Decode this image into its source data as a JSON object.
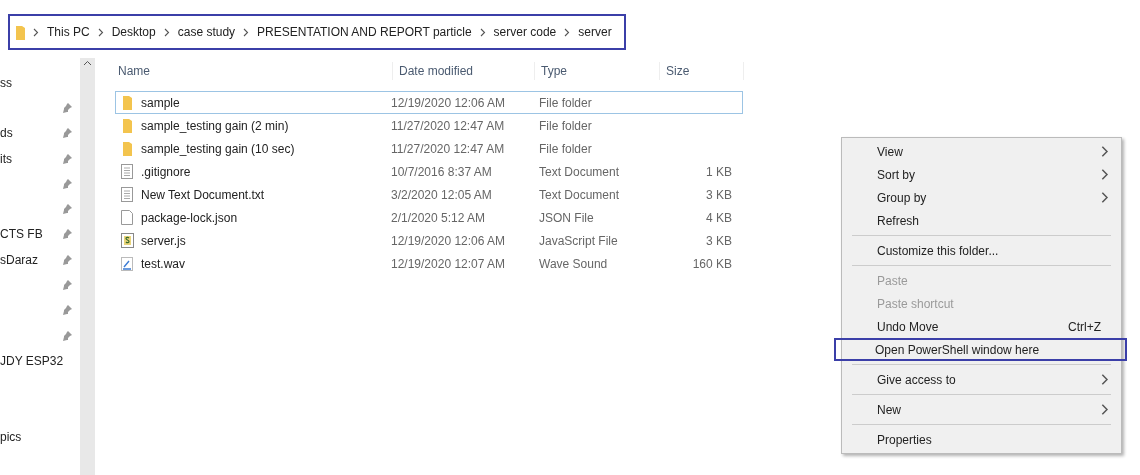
{
  "address_bar": {
    "annotated": true,
    "segments": [
      "This PC",
      "Desktop",
      "case study",
      "PRESENTATION AND REPORT particle",
      "server code",
      "server"
    ]
  },
  "sidebar": {
    "items": [
      {
        "label": "ss",
        "pinned": false
      },
      {
        "pinned": true
      },
      {
        "label": "ds",
        "pinned": true
      },
      {
        "label": "its",
        "pinned": true
      },
      {
        "pinned": true
      },
      {
        "pinned": true
      },
      {
        "label": "CTS FB",
        "pinned": true
      },
      {
        "label": "sDaraz",
        "pinned": true
      },
      {
        "pinned": true
      },
      {
        "pinned": true
      },
      {
        "pinned": true
      },
      {
        "label": "JDY ESP32",
        "pinned": false
      },
      {
        "pinned": false
      },
      {
        "pinned": false
      },
      {
        "label": "pics",
        "pinned": false
      }
    ]
  },
  "table": {
    "columns": [
      "Name",
      "Date modified",
      "Type",
      "Size"
    ],
    "rows": [
      {
        "kind": "folder",
        "name": "sample",
        "date": "12/19/2020 12:06 AM",
        "type": "File folder",
        "focused": true
      },
      {
        "kind": "folder",
        "name": "sample_testing gain (2 min)",
        "date": "11/27/2020 12:47 AM",
        "type": "File folder",
        "focused": false
      },
      {
        "kind": "folder",
        "name": "sample_testing gain (10 sec)",
        "date": "11/27/2020 12:47 AM",
        "type": "File folder",
        "focused": false
      },
      {
        "kind": "text",
        "name": ".gitignore",
        "date": "10/7/2016 8:37 AM",
        "type": "Text Document",
        "size": "1 KB",
        "focused": false
      },
      {
        "kind": "text",
        "name": "New Text Document.txt",
        "date": "3/2/2020 12:05 AM",
        "type": "Text Document",
        "size": "3 KB",
        "focused": false
      },
      {
        "kind": "blank",
        "name": "package-lock.json",
        "date": "2/1/2020 5:12 AM",
        "type": "JSON File",
        "size": "4 KB",
        "focused": false
      },
      {
        "kind": "script",
        "name": "server.js",
        "date": "12/19/2020 12:06 AM",
        "type": "JavaScript File",
        "size": "3 KB",
        "focused": false
      },
      {
        "kind": "audio",
        "name": "test.wav",
        "date": "12/19/2020 12:07 AM",
        "type": "Wave Sound",
        "size": "160 KB",
        "focused": false
      }
    ]
  },
  "context_menu": {
    "items": [
      {
        "kind": "item",
        "label": "View",
        "submenu": true,
        "disabled": false,
        "annotated": false
      },
      {
        "kind": "item",
        "label": "Sort by",
        "submenu": true,
        "disabled": false,
        "annotated": false
      },
      {
        "kind": "item",
        "label": "Group by",
        "submenu": true,
        "disabled": false,
        "annotated": false
      },
      {
        "kind": "item",
        "label": "Refresh",
        "submenu": false,
        "disabled": false,
        "annotated": false
      },
      {
        "kind": "separator"
      },
      {
        "kind": "item",
        "label": "Customize this folder...",
        "submenu": false,
        "disabled": false,
        "annotated": false
      },
      {
        "kind": "separator"
      },
      {
        "kind": "item",
        "label": "Paste",
        "submenu": false,
        "disabled": true,
        "annotated": false
      },
      {
        "kind": "item",
        "label": "Paste shortcut",
        "submenu": false,
        "disabled": true,
        "annotated": false
      },
      {
        "kind": "item",
        "label": "Undo Move",
        "shortcut": "Ctrl+Z",
        "submenu": false,
        "disabled": false,
        "annotated": false
      },
      {
        "kind": "item",
        "label": "Open PowerShell window here",
        "submenu": false,
        "disabled": false,
        "annotated": true
      },
      {
        "kind": "separator"
      },
      {
        "kind": "item",
        "label": "Give access to",
        "submenu": true,
        "disabled": false,
        "annotated": false
      },
      {
        "kind": "separator"
      },
      {
        "kind": "item",
        "label": "New",
        "submenu": true,
        "disabled": false,
        "annotated": false
      },
      {
        "kind": "separator"
      },
      {
        "kind": "item",
        "label": "Properties",
        "submenu": false,
        "disabled": false,
        "annotated": false
      }
    ]
  }
}
